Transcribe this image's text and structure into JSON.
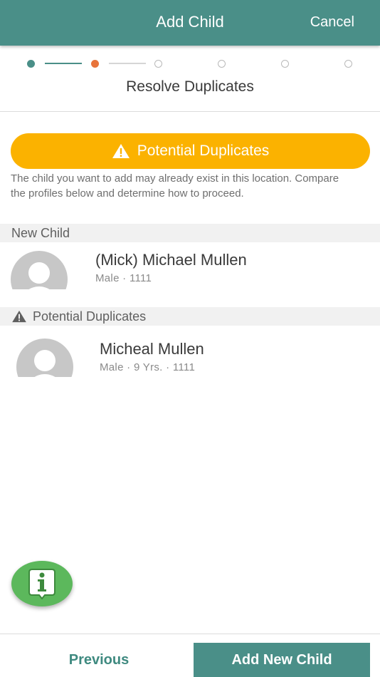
{
  "header": {
    "title": "Add Child",
    "cancel_label": "Cancel"
  },
  "stepper": {
    "total_steps": 6,
    "current_step": 2
  },
  "page": {
    "subtitle": "Resolve Duplicates"
  },
  "warning": {
    "icon": "warning-triangle-icon",
    "label": "Potential Duplicates",
    "color": "#fbb200",
    "description": "The child you want to add may already exist in this location. Compare the profiles below and determine how to proceed."
  },
  "new_child_section": {
    "header": "New Child",
    "child": {
      "name": "(Mick) Michael Mullen",
      "meta": "Male · 1111"
    }
  },
  "duplicates_section": {
    "icon": "warning-triangle-icon",
    "header": "Potential Duplicates",
    "children": [
      {
        "name": "Micheal Mullen",
        "meta": "Male · 9 Yrs. · 1111"
      }
    ]
  },
  "fab": {
    "icon": "info-icon"
  },
  "footer": {
    "previous_label": "Previous",
    "add_label": "Add New Child"
  },
  "colors": {
    "primary": "#4a8f88",
    "current_step": "#e8743b",
    "warning": "#fbb200",
    "fab": "#5cb85c"
  }
}
